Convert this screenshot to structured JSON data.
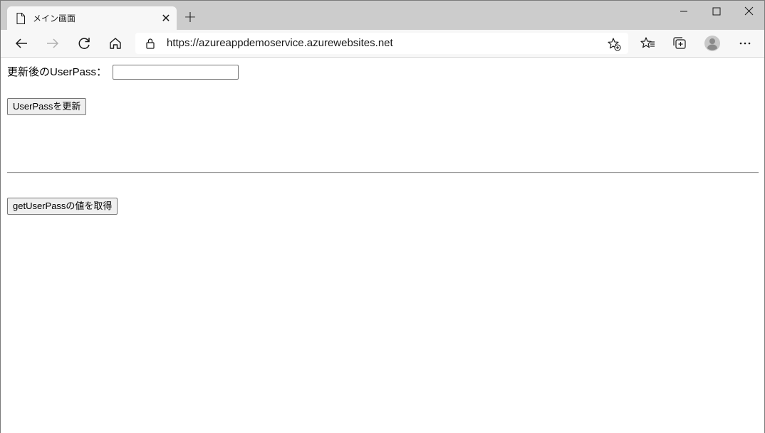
{
  "browser": {
    "tab": {
      "title": "メイン画面",
      "close_glyph": "✕"
    },
    "new_tab_glyph": "+",
    "address": {
      "url": "https://azureappdemoservice.azurewebsites.net"
    },
    "window_controls": {
      "minimize": "minimize-icon",
      "maximize": "maximize-icon",
      "close": "close-icon"
    }
  },
  "page": {
    "field_label": "更新後のUserPass：",
    "field_value": "",
    "update_button_label": "UserPassを更新",
    "get_button_label": "getUserPassの値を取得"
  }
}
